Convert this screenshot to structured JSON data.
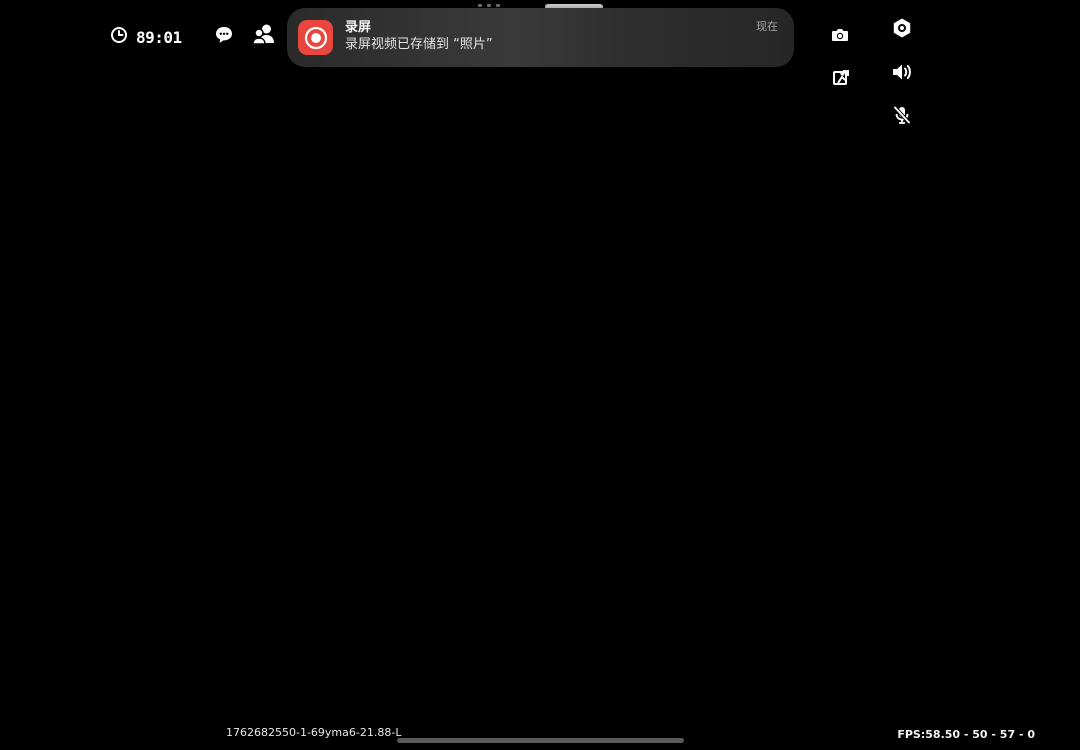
{
  "hud": {
    "timer": "89:01",
    "icons": {
      "timer": "clock-icon",
      "chat": "chat-bubble-icon",
      "friends": "users-icon",
      "camera": "camera-icon",
      "share": "share-screen-icon",
      "settings": "gear-icon",
      "sound": "speaker-icon",
      "mic": "mic-muted-icon"
    }
  },
  "notification": {
    "title": "录屏",
    "body": "录屏视频已存储到 “照片”",
    "time": "现在",
    "icon": "screen-record-icon",
    "icon_color": "#e94640"
  },
  "footer": {
    "build_id": "1762682550-1-69yma6-21.88-L",
    "fps": "FPS:58.50 - 50 - 57 - 0"
  }
}
